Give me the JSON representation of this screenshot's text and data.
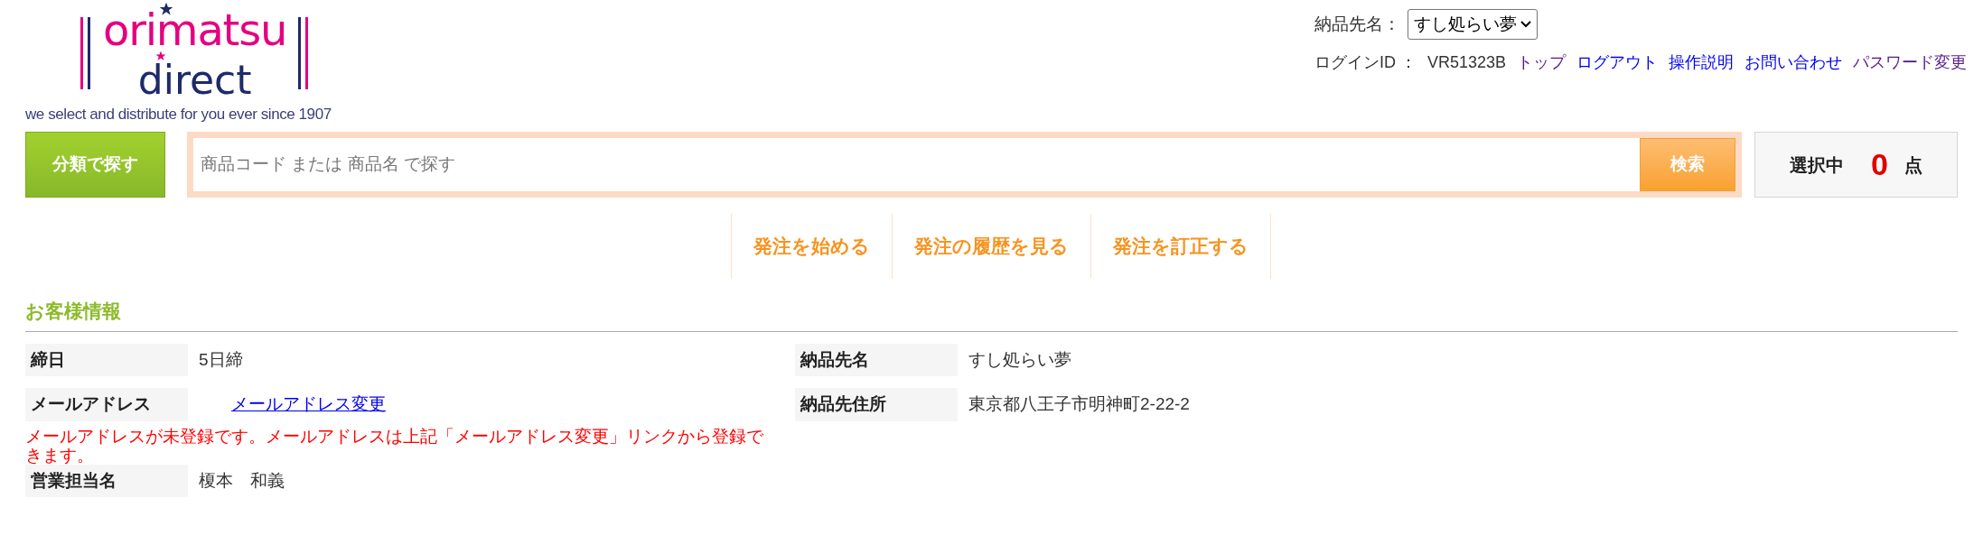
{
  "logo": {
    "line1": "orimatsu",
    "line2": "direct",
    "tagline": "we select and distribute for you ever since 1907"
  },
  "header": {
    "delivery_label": "納品先名：",
    "delivery_select": "すし処らい夢",
    "login_label": "ログインID ：",
    "login_id": "VR51323B",
    "links": [
      {
        "label": "トップ",
        "visited": true
      },
      {
        "label": "ログアウト",
        "visited": false
      },
      {
        "label": "操作説明",
        "visited": false
      },
      {
        "label": "お問い合わせ",
        "visited": false
      },
      {
        "label": "パスワード変更",
        "visited": true
      }
    ]
  },
  "search": {
    "category_button": "分類で探す",
    "placeholder": "商品コード または 商品名 で探す",
    "search_button": "検索",
    "selected_label": "選択中",
    "selected_count": "0",
    "selected_unit": "点"
  },
  "nav": [
    "発注を始める",
    "発注の履歴を見る",
    "発注を訂正する"
  ],
  "section_title": "お客様情報",
  "info": {
    "closing_label": "締日",
    "closing_value": "5日締",
    "delivery_name_label": "納品先名",
    "delivery_name_value": "すし処らい夢",
    "email_label": "メールアドレス",
    "email_link": "メールアドレス変更",
    "address_label": "納品先住所",
    "address_value": "東京都八王子市明神町2-22-2",
    "email_warning": "メールアドレスが未登録です。メールアドレスは上記「メールアドレス変更」リンクから登録できます。",
    "sales_label": "営業担当名",
    "sales_value": "榎本　和義"
  }
}
